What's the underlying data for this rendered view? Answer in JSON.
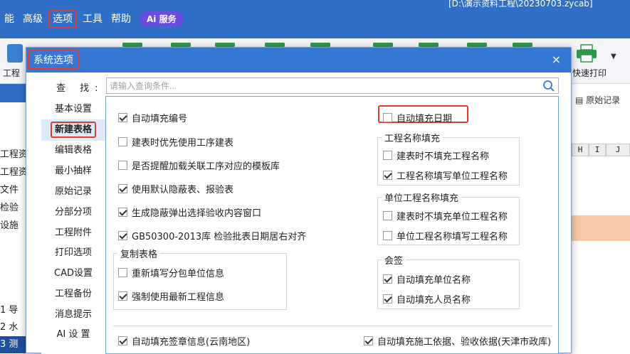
{
  "app": {
    "menu": [
      "能",
      "高级",
      "选项",
      "工具",
      "帮助"
    ],
    "ai_label": "Ai 服务",
    "path_text": "[D:\\演示资料工程\\20230703.zycab]",
    "toolbar_left_label": "工程",
    "quick_print_label": "快速打印",
    "original_record_label": "原始记录",
    "columns": [
      "H",
      "I",
      "J"
    ],
    "tree_fragments": [
      "工程资",
      "工程资",
      "文件",
      "检验",
      "设施",
      "1 导",
      "2 水",
      "3 测"
    ]
  },
  "dialog": {
    "title": "系统选项",
    "close_glyph": "×",
    "search": {
      "label": "查 找:",
      "placeholder": "请输入查询条件..."
    },
    "nav": [
      {
        "label": "基本设置"
      },
      {
        "label": "新建表格",
        "active": true
      },
      {
        "label": "编辑表格"
      },
      {
        "label": "最小抽样"
      },
      {
        "label": "原始记录"
      },
      {
        "label": "分部分项"
      },
      {
        "label": "工程附件"
      },
      {
        "label": "打印选项"
      },
      {
        "label": "CAD设置"
      },
      {
        "label": "工程备份"
      },
      {
        "label": "消息提示"
      },
      {
        "label": "AI 设 置"
      }
    ],
    "options_left": [
      {
        "label": "自动填充编号",
        "checked": true
      },
      {
        "label": "建表时优先使用工序建表",
        "checked": false
      },
      {
        "label": "是否提醒加载关联工序对应的模板库",
        "checked": false
      },
      {
        "label": "使用默认隐蔽表、报验表",
        "checked": true
      },
      {
        "label": "生成隐蔽弹出选择验收内容窗口",
        "checked": true
      },
      {
        "label": "GB50300-2013库 检验批表日期居右对齐",
        "checked": true
      }
    ],
    "copy_group": {
      "title": "复制表格",
      "items": [
        {
          "label": "重新填写分包单位信息",
          "checked": false
        },
        {
          "label": "强制使用最新工程信息",
          "checked": true
        }
      ]
    },
    "auto_date": {
      "label": "自动填充日期",
      "checked": false
    },
    "project_name_group": {
      "title": "工程名称填充",
      "items": [
        {
          "label": "建表时不填充工程名称",
          "checked": false
        },
        {
          "label": "工程名称填写单位工程名称",
          "checked": true
        }
      ]
    },
    "unit_name_group": {
      "title": "单位工程名称填充",
      "items": [
        {
          "label": "建表时不填充单位工程名称",
          "checked": false
        },
        {
          "label": "单位工程名称填写工程名称",
          "checked": false
        }
      ]
    },
    "sign_group": {
      "title": "会签",
      "items": [
        {
          "label": "自动填充单位名称",
          "checked": true
        },
        {
          "label": "自动填充人员名称",
          "checked": true
        }
      ]
    },
    "bottom_left": {
      "label": "自动填充签章信息(云南地区)",
      "checked": true
    },
    "bottom_right": {
      "label": "自动填充施工依据、验收依据(天津市政库)",
      "checked": true
    }
  },
  "colors": {
    "accent": "#3578d4",
    "highlight": "#e23a2e",
    "nav_active": "#dce9f8"
  }
}
